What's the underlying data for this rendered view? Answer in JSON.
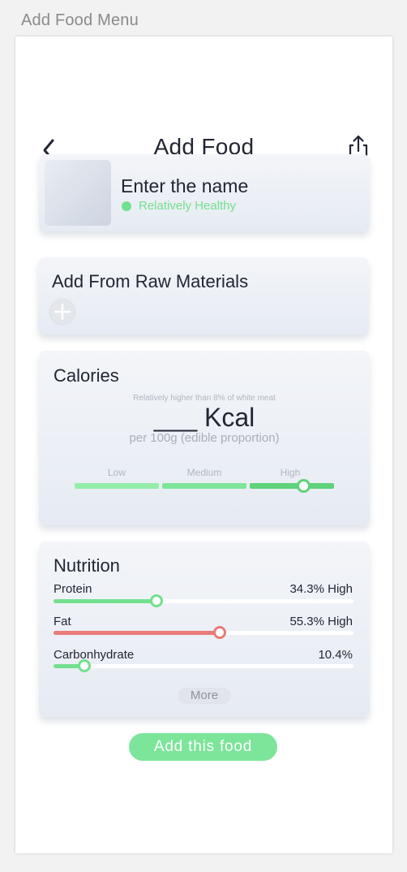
{
  "frame_title": "Add Food Menu",
  "header": {
    "title": "Add Food",
    "back_icon": "chevron-left-icon",
    "share_icon": "share-icon"
  },
  "food": {
    "name_placeholder": "Enter the name",
    "health_status": "Relatively Healthy",
    "health_color": "#73e08d"
  },
  "raw_materials": {
    "title": "Add From Raw Materials",
    "add_icon": "plus-icon"
  },
  "calories": {
    "title": "Calories",
    "comparison_note": "Relatively higher than 8% of white meat",
    "value": "___ Kcal",
    "unit_note": "per 100g (edible proportion)",
    "levels": [
      "Low",
      "Medium",
      "High"
    ],
    "selected_level": "High",
    "level_position": 0.88
  },
  "nutrition": {
    "title": "Nutrition",
    "items": [
      {
        "label": "Protein",
        "value": "34.3% High",
        "fraction": 0.343,
        "color": "#73e08d"
      },
      {
        "label": "Fat",
        "value": "55.3% High",
        "fraction": 0.553,
        "color": "#e87b78"
      },
      {
        "label": "Carbonhydrate",
        "value": "10.4%",
        "fraction": 0.104,
        "color": "#73e08d"
      }
    ],
    "more_label": "More"
  },
  "add_button_label": "Add this food",
  "colors": {
    "accent_green": "#73e08d",
    "fat_red": "#e87b78"
  }
}
